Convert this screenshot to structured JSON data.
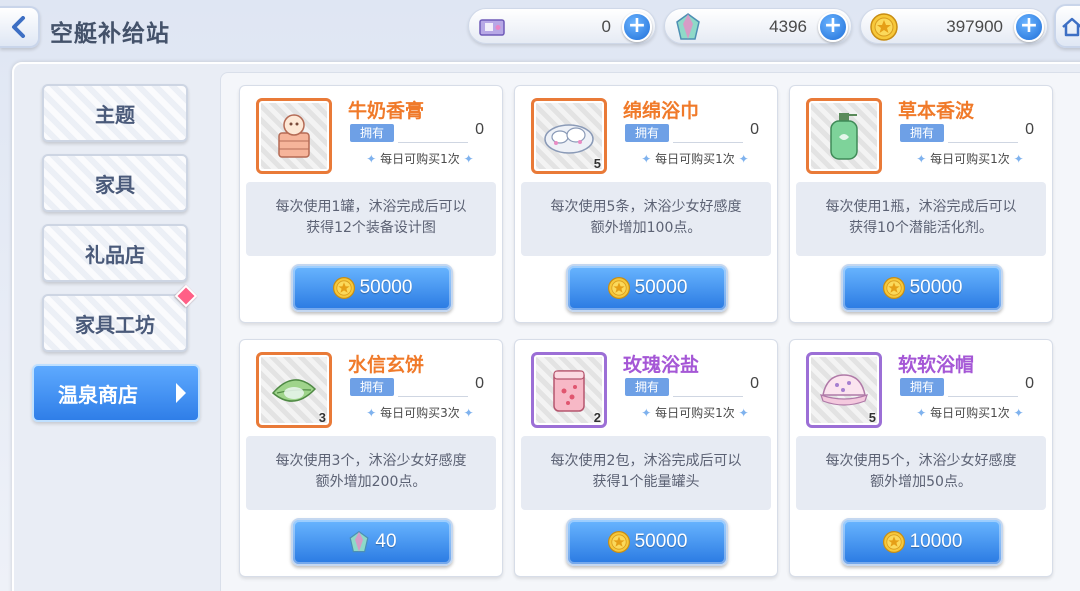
{
  "header": {
    "title": "空艇补给站",
    "currencies": [
      {
        "icon": "ticket-icon",
        "value": "0"
      },
      {
        "icon": "gem-icon",
        "value": "4396"
      },
      {
        "icon": "coin-icon",
        "value": "397900"
      }
    ]
  },
  "sidebar": {
    "items": [
      {
        "label": "主题"
      },
      {
        "label": "家具"
      },
      {
        "label": "礼品店"
      },
      {
        "label": "家具工坊"
      },
      {
        "label": "温泉商店"
      }
    ]
  },
  "shop": {
    "own_label": "拥有",
    "items": [
      {
        "name": "牛奶香膏",
        "own": "0",
        "limit": "每日可购买1次",
        "qty": "",
        "desc1": "每次使用1罐，沐浴完成后可以",
        "desc2": "获得12个装备设计图",
        "price": "50000",
        "currency": "coin-icon",
        "item_icon": "milk-cream-icon",
        "rarity": "orange"
      },
      {
        "name": "绵绵浴巾",
        "own": "0",
        "limit": "每日可购买1次",
        "qty": "5",
        "desc1": "每次使用5条，沐浴少女好感度",
        "desc2": "额外增加100点。",
        "price": "50000",
        "currency": "coin-icon",
        "item_icon": "towel-icon",
        "rarity": "orange"
      },
      {
        "name": "草本香波",
        "own": "0",
        "limit": "每日可购买1次",
        "qty": "",
        "desc1": "每次使用1瓶，沐浴完成后可以",
        "desc2": "获得10个潜能活化剂。",
        "price": "50000",
        "currency": "coin-icon",
        "item_icon": "shampoo-bottle-icon",
        "rarity": "orange"
      },
      {
        "name": "水信玄饼",
        "own": "0",
        "limit": "每日可购买3次",
        "qty": "3",
        "desc1": "每次使用3个，沐浴少女好感度",
        "desc2": "额外增加200点。",
        "price": "40",
        "currency": "gem-icon",
        "item_icon": "leaf-cake-icon",
        "rarity": "orange"
      },
      {
        "name": "玫瑰浴盐",
        "own": "0",
        "limit": "每日可购买1次",
        "qty": "2",
        "desc1": "每次使用2包，沐浴完成后可以",
        "desc2": "获得1个能量罐头",
        "price": "50000",
        "currency": "coin-icon",
        "item_icon": "bath-salt-jar-icon",
        "rarity": "purple"
      },
      {
        "name": "软软浴帽",
        "own": "0",
        "limit": "每日可购买1次",
        "qty": "5",
        "desc1": "每次使用5个，沐浴少女好感度",
        "desc2": "额外增加50点。",
        "price": "10000",
        "currency": "coin-icon",
        "item_icon": "bath-cap-icon",
        "rarity": "purple"
      }
    ]
  }
}
